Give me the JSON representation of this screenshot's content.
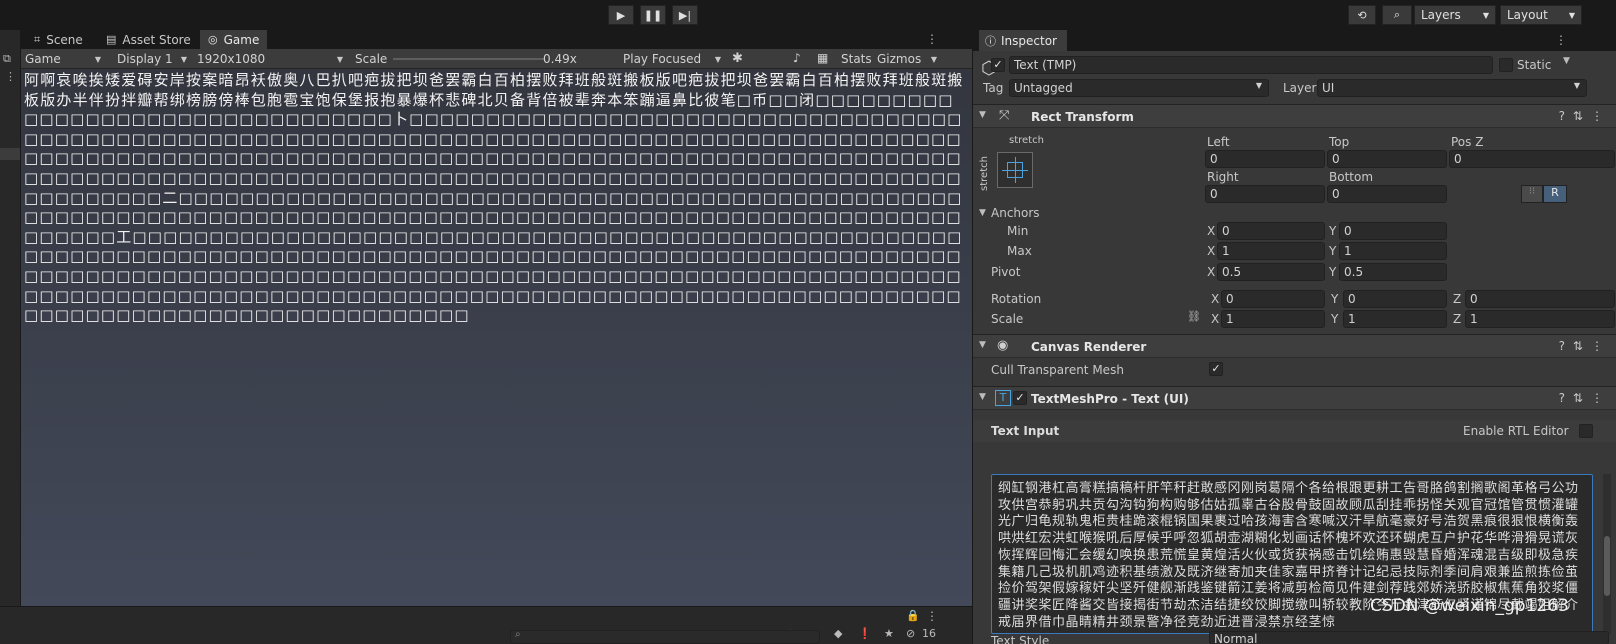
{
  "toolbar": {
    "history_icon": "history-icon",
    "search_icon": "search-icon",
    "layers_label": "Layers",
    "layout_label": "Layout"
  },
  "tabs": [
    {
      "label": "Scene",
      "icon": "scene-icon"
    },
    {
      "label": "Asset Store",
      "icon": "store-icon"
    },
    {
      "label": "Game",
      "icon": "gamepad-icon",
      "active": true
    }
  ],
  "game_toolbar": {
    "view": "Game",
    "display": "Display 1",
    "resolution": "1920x1080",
    "scale_label": "Scale",
    "scale_value": "0.49x",
    "play_mode": "Play Focused",
    "stats": "Stats",
    "gizmos": "Gizmos"
  },
  "game_view": {
    "text": "阿啊哀唉挨矮爱碍安岸按案暗昂袄傲奥八巴扒吧疤拔把坝爸罢霸白百柏摆败拜班般斑搬板版吧疤拔把坝爸罢霸白百柏摆败拜班般斑搬板版办半伴扮拌瓣帮绑榜膀傍棒包胞雹宝饱保堡报抱暴爆杯悲碑北贝备背倍被辈奔本笨蹦逼鼻比彼笔□币□□闭□□□□□□□□□□□□□□□□□□□□□□□□□□□□□□□□□卜□□□□□□□□□□□□□□□□□□□□□□□□□□□□□□□□□□□□□□□□□□□□□□□□□□□□□□□□□□□□□□□□□□□□□□□□□□□□□□□□□□□□□□□□□□□□□□□□□□□□□□□□□□□□□□□□□□□□□□□□□□□□□□□□□□□□□□□□□□□□□□□□□□□□□□□□□□□□□□□□□□□□□□□□□□□□□□□□□□□□□□□□□□□□□□□□□□□□□□□□□□□□□□□□□□□□□□□□□□□□□□□□□□□□二□□□□□□□□□□□□□□□□□□□□□□□□□□□□□□□□□□□□□□□□□□□□□□□□□□□□□□□□□□□□□□□□□□□□□□□□□□□□□□□□□□□□□□□□□□□□□□□□□□□□□□□□□□□□□□□□□□□□□□工□□□□□□□□□□□□□□□□□□□□□□□□□□□□□□□□□□□□□□□□□□□□□□□□□□□□□□□□□□□□□□□□□□□□□□□□□□□□□□□□□□□□□□□□□□□□□□□□□□□□□□□□□□□□□□□□□□□□□□□□□□□□□□□□□□□□□□□□□□□□□□□□□□□□□□□□□□□□□□□□□□□□□□□□□□□□□□□□□□□□□□□□□□□□□□□□□□□□□□□□□□□□□□□□□□□□□□□□□□□□□□□□□□□□□□□□□□□□□□□□□□□□□□□□□□□□□□□□□□□□□□□□□□"
  },
  "bottom_bar": {
    "hidden_count": "16"
  },
  "inspector": {
    "tab_label": "Inspector",
    "object_name": "Text (TMP)",
    "static_label": "Static",
    "tag_label": "Tag",
    "tag_value": "Untagged",
    "layer_label": "Layer",
    "layer_value": "UI",
    "rect_transform": {
      "title": "Rect Transform",
      "anchor_preset_h": "stretch",
      "anchor_preset_v": "stretch",
      "left_label": "Left",
      "left": "0",
      "top_label": "Top",
      "top": "0",
      "posz_label": "Pos Z",
      "posz": "0",
      "right_label": "Right",
      "right": "0",
      "bottom_label": "Bottom",
      "bottom": "0",
      "raw_button": "R",
      "anchors_label": "Anchors",
      "min_label": "Min",
      "min_x": "0",
      "min_y": "0",
      "max_label": "Max",
      "max_x": "1",
      "max_y": "1",
      "pivot_label": "Pivot",
      "pivot_x": "0.5",
      "pivot_y": "0.5",
      "rotation_label": "Rotation",
      "rot_x": "0",
      "rot_y": "0",
      "rot_z": "0",
      "scale_label": "Scale",
      "scale_x": "1",
      "scale_y": "1",
      "scale_z": "1",
      "x": "X",
      "y": "Y",
      "z": "Z"
    },
    "canvas_renderer": {
      "title": "Canvas Renderer",
      "cull_label": "Cull Transparent Mesh"
    },
    "tmp": {
      "title": "TextMeshPro - Text (UI)",
      "text_input_label": "Text Input",
      "rtl_label": "Enable RTL Editor",
      "text": "纲缸钢港杠高膏糕搞稿杆肝竿秆赶敢感冈刚岗葛隔个各给根跟更耕工告哥胳鸽割搁歌阁革格弓公功攻供宫恭躬巩共贡勾沟钩狗构购够估姑孤辜古谷股骨鼓固故顾瓜刮挂乖拐怪关观官冠馆管贯惯灌罐光广归龟规轨鬼柜贵桂跪滚棍锅国果裹过哈孩海害含寒喊汉汗旱航毫豪好号浩贺黑痕很狠恨横衡轰哄烘红宏洪虹喉猴吼后厚候乎呼忽狐胡壶湖糊化划画话怀槐坏欢还环蝴虎互户护花华哗滑猾晃谎灰恢挥辉回悔汇会缓幻唤换患荒慌皇黄煌活火伙或货获祸感击饥绘贿惠毁慧昏婚浑魂混吉级即极急疾集籍几己圾机肌鸡迹积基绩激及既济继寄加夹佳家嘉甲挤脊计记纪忌技际剂季间肩艰兼监煎拣俭茧捡价驾架假嫁稼奸尖坚歼健舰渐践鉴键箭江姜将减剪检简见件建剑荐践郊娇浇骄胶椒焦蕉角狡浆僵疆讲奖桨匠降酱交皆接揭街节劫杰洁结捷绞饺脚搅缴叫轿较教阶今斤金津筋仅紧谨锦尽截竭姐解介戒届界借巾晶睛精井颈景警净径竞劲近进晋浸禁京经茎惊",
      "text_style_label": "Text Style",
      "text_style_value": "Normal"
    }
  },
  "watermark": "CSDN @weixin_gp1263"
}
